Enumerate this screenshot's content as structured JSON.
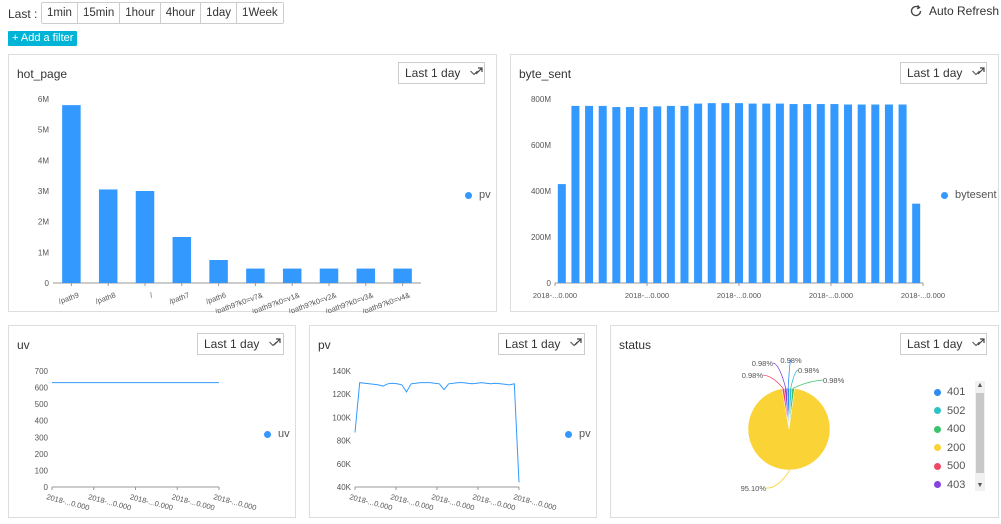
{
  "topbar": {
    "last_label": "Last :",
    "ranges": [
      "1min",
      "15min",
      "1hour",
      "4hour",
      "1day",
      "1Week"
    ],
    "auto_refresh": "Auto Refresh",
    "add_filter": "+ Add a filter"
  },
  "panels": {
    "hot_page": {
      "title": "hot_page",
      "range": "Last 1 day"
    },
    "byte_sent": {
      "title": "byte_sent",
      "range": "Last 1 day"
    },
    "uv": {
      "title": "uv",
      "range": "Last 1 day"
    },
    "pv": {
      "title": "pv",
      "range": "Last 1 day"
    },
    "status": {
      "title": "status",
      "range": "Last 1 day"
    }
  },
  "chart_data": [
    {
      "id": "hot_page",
      "type": "bar",
      "categories": [
        "/path9",
        "/path8",
        "/",
        "/path7",
        "/path6",
        "/path9?k0=v7&",
        "/path9?k0=v1&",
        "/path9?k0=v2&",
        "/path9?k0=v3&",
        "/path9?k0=v4&"
      ],
      "series": [
        {
          "name": "pv",
          "values": [
            5800000,
            3050000,
            3000000,
            1500000,
            750000,
            470000,
            470000,
            470000,
            470000,
            470000
          ]
        }
      ],
      "yticks": [
        "0",
        "1M",
        "2M",
        "3M",
        "4M",
        "5M",
        "6M"
      ],
      "ylim": [
        0,
        6000000
      ],
      "legend": "right",
      "color": "#3399ff"
    },
    {
      "id": "byte_sent",
      "type": "bar",
      "x_ticks": [
        "2018-...0.000",
        "2018-...0.000",
        "2018-...0.000",
        "2018-...0.000",
        "2018-...0.000"
      ],
      "series": [
        {
          "name": "bytesent",
          "values": [
            430,
            770,
            770,
            770,
            765,
            765,
            765,
            768,
            770,
            770,
            780,
            782,
            782,
            782,
            780,
            780,
            780,
            778,
            778,
            778,
            778,
            776,
            776,
            776,
            776,
            776,
            345
          ]
        }
      ],
      "yticks": [
        "0",
        "200M",
        "400M",
        "600M",
        "800M"
      ],
      "ylim": [
        0,
        800
      ],
      "legend": "right",
      "color": "#3399ff"
    },
    {
      "id": "uv",
      "type": "line",
      "x_ticks": [
        "2018-...0.000",
        "2018-...0.000",
        "2018-...0.000",
        "2018-...0.000",
        "2018-...0.000"
      ],
      "series": [
        {
          "name": "uv",
          "values": [
            630,
            630,
            630,
            630,
            630,
            630,
            630,
            630,
            630,
            630
          ]
        }
      ],
      "yticks": [
        "0",
        "100",
        "200",
        "300",
        "400",
        "500",
        "600",
        "700"
      ],
      "ylim": [
        0,
        700
      ],
      "legend": "right",
      "color": "#3399ff"
    },
    {
      "id": "pv",
      "type": "line",
      "x_ticks": [
        "2018-...0.000",
        "2018-...0.000",
        "2018-...0.000",
        "2018-...0.000",
        "2018-...0.000"
      ],
      "series": [
        {
          "name": "pv",
          "values": [
            87000,
            130000,
            129500,
            129000,
            128500,
            128000,
            127000,
            129000,
            129500,
            129000,
            128000,
            122000,
            129000,
            129500,
            130000,
            130000,
            130000,
            129500,
            129000,
            124000,
            129000,
            129500,
            130000,
            130000,
            129500,
            129000,
            129500,
            130000,
            129500,
            129000,
            129500,
            129000,
            128500,
            128000,
            129000,
            44000
          ]
        }
      ],
      "yticks": [
        "40K",
        "60K",
        "80K",
        "100K",
        "120K",
        "140K"
      ],
      "ylim": [
        40000,
        140000
      ],
      "legend": "right",
      "color": "#3399ff"
    },
    {
      "id": "status",
      "type": "pie",
      "slices": [
        {
          "name": "401",
          "value": 0.98,
          "label": "0.98%",
          "color": "#2d8cf0"
        },
        {
          "name": "502",
          "value": 0.98,
          "label": "0.98%",
          "color": "#2dc3c3"
        },
        {
          "name": "400",
          "value": 0.98,
          "label": "0.98%",
          "color": "#3cc46b"
        },
        {
          "name": "200",
          "value": 95.1,
          "label": "95.10%",
          "color": "#fad337"
        },
        {
          "name": "500",
          "value": 0.98,
          "label": "0.98%",
          "color": "#f04864"
        },
        {
          "name": "403",
          "value": 0.98,
          "label": "0.98%",
          "color": "#8543e0"
        }
      ],
      "legend": "right"
    }
  ]
}
